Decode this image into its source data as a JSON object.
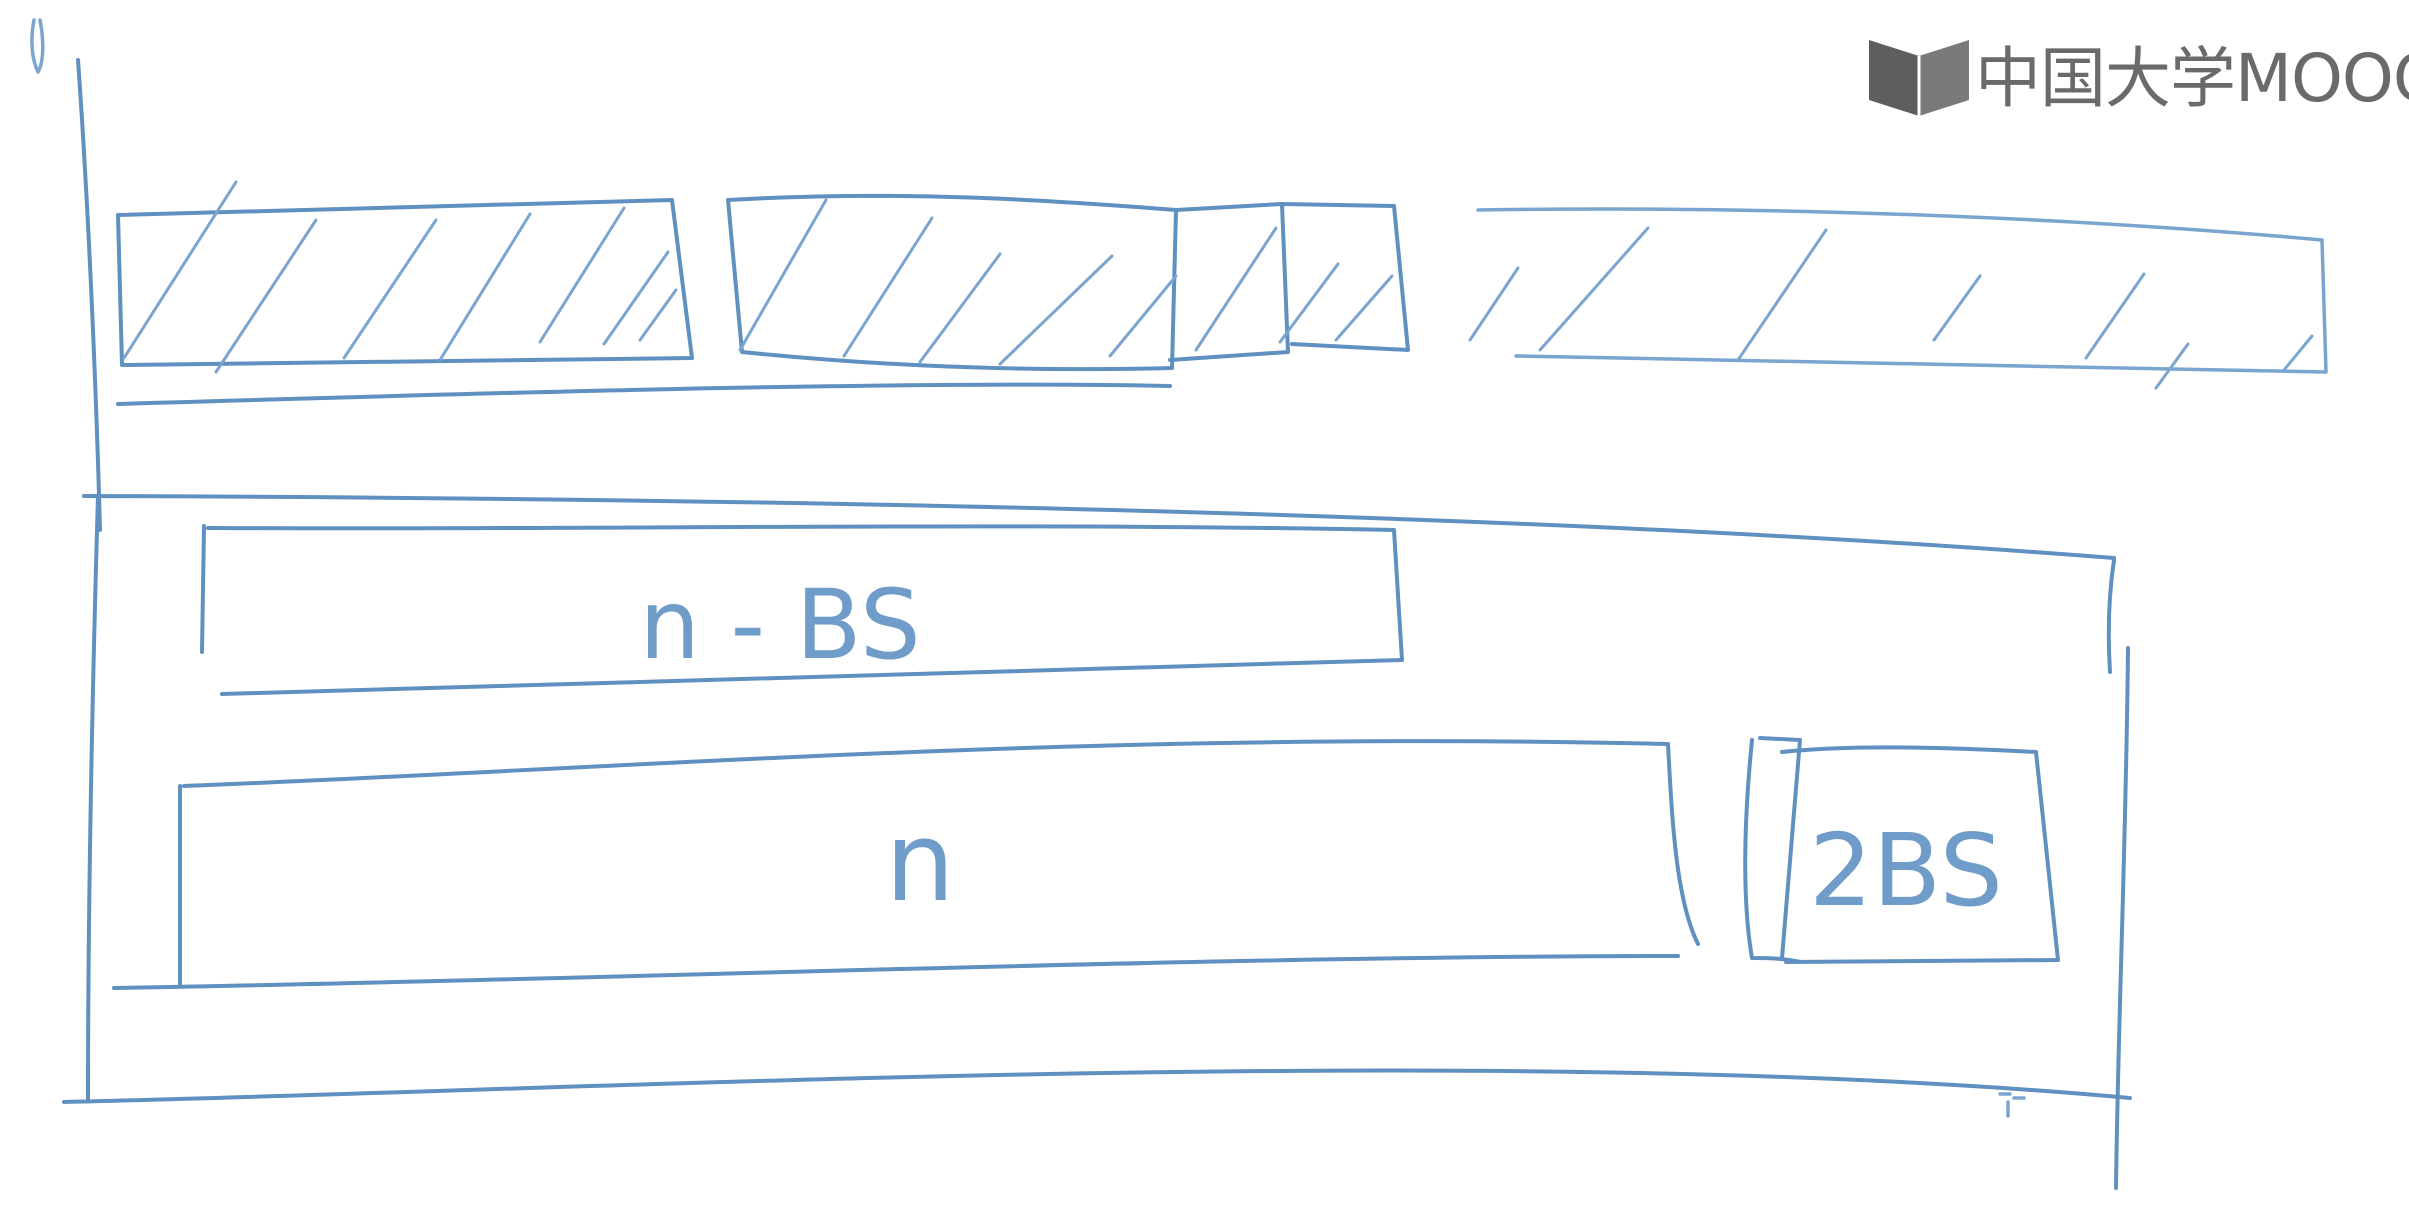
{
  "labels": {
    "top_block": "n - BS",
    "main_block": "n",
    "side_block": "2BS"
  },
  "logo": {
    "text": "中国大学MOOC"
  },
  "colors": {
    "ink": "#5f90bf",
    "logo_gray": "#6a6a6a"
  }
}
